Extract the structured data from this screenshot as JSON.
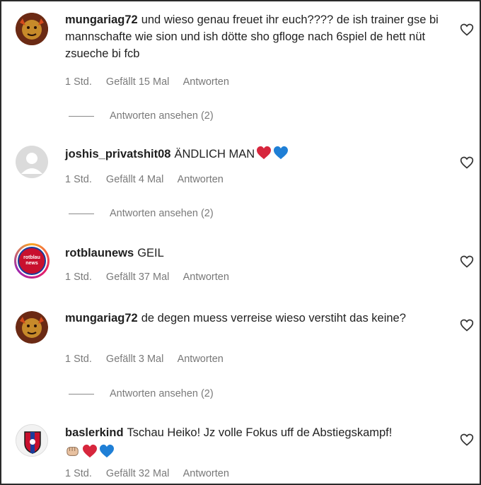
{
  "comments": [
    {
      "username": "mungariag72",
      "text": "und wieso genau freuet ihr euch???? de ish trainer gse bi mannschafte wie sion und ish dötte sho gfloge nach 6spiel de hett nüt zsueche bi fcb",
      "time": "1 Std.",
      "likes": "Gefällt 15 Mal",
      "reply": "Antworten",
      "view_replies": "Antworten ansehen (2)"
    },
    {
      "username": "joshis_privatshit08",
      "text": "ÄNDLICH MAN",
      "time": "1 Std.",
      "likes": "Gefällt 4 Mal",
      "reply": "Antworten",
      "view_replies": "Antworten ansehen (2)"
    },
    {
      "username": "rotblaunews",
      "text": "GEIL",
      "time": "1 Std.",
      "likes": "Gefällt 37 Mal",
      "reply": "Antworten",
      "avatar_text": "rotblau news"
    },
    {
      "username": "mungariag72",
      "text": "de degen muess verreise wieso verstiht das keine?",
      "time": "1 Std.",
      "likes": "Gefällt 3 Mal",
      "reply": "Antworten",
      "view_replies": "Antworten ansehen (2)"
    },
    {
      "username": "baslerkind",
      "text": "Tschau Heiko! Jz volle Fokus uff de Abstiegskampf!",
      "time": "1 Std.",
      "likes": "Gefällt 32 Mal",
      "reply": "Antworten"
    }
  ],
  "colors": {
    "red_heart": "#d7263d",
    "blue_heart": "#1f7fd6",
    "text_gray": "#7a7a7a"
  }
}
